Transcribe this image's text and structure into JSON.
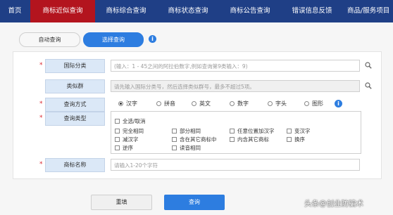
{
  "nav": {
    "items": [
      {
        "label": "首页",
        "active": false
      },
      {
        "label": "商标近似查询",
        "active": true
      },
      {
        "label": "商标综合查询",
        "active": false
      },
      {
        "label": "商标状态查询",
        "active": false
      },
      {
        "label": "商标公告查询",
        "active": false
      },
      {
        "label": "错误信息反馈",
        "active": false
      },
      {
        "label": "商品/服务项目",
        "active": false
      }
    ]
  },
  "mode_tabs": {
    "auto": "自动查询",
    "select": "选择查询",
    "info_icon": "info-icon"
  },
  "form": {
    "required_mark": "*",
    "intl_class": {
      "label": "国际分类",
      "placeholder": "(输入：1 - 45之间的阿拉伯数字,例如查询第9类输入：9)"
    },
    "similar_group": {
      "label": "类似群",
      "placeholder": "请先输入国际分类号，然后选择类似群号，最多不超过5项。"
    },
    "query_method": {
      "label": "查询方式",
      "options": [
        "汉字",
        "拼音",
        "英文",
        "数字",
        "字头",
        "图形"
      ],
      "selected": "汉字"
    },
    "query_type": {
      "label": "查询类型",
      "select_all": "全选/取消",
      "options": [
        "完全相同",
        "部分相同",
        "任意位置加汉字",
        "变汉字",
        "减汉字",
        "含在其它商标中",
        "内含其它商标",
        "换序",
        "逆序",
        "读音相同"
      ]
    },
    "trademark_name": {
      "label": "商标名称",
      "placeholder": "请输入1-20个字符"
    }
  },
  "buttons": {
    "reset": "重填",
    "query": "查询"
  },
  "watermark": "头条@创业防骗术",
  "colors": {
    "nav_bg": "#1f3f86",
    "nav_active": "#b3141e",
    "primary": "#2d7de0",
    "required": "#d9252e"
  }
}
